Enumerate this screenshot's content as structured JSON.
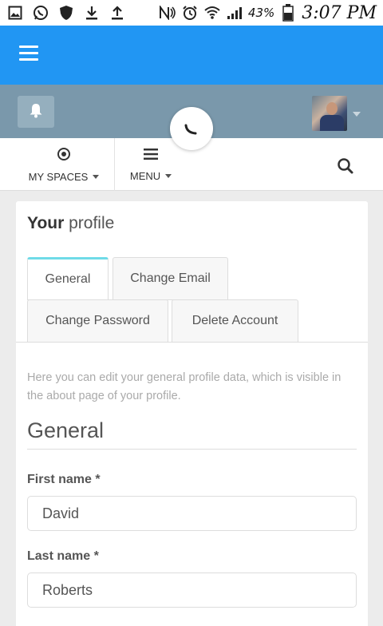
{
  "status_bar": {
    "battery_percent": "43%",
    "time": "3:07 PM",
    "icons": [
      "gallery-icon",
      "whatsapp-icon",
      "shield-icon",
      "download-icon",
      "upload-icon",
      "nfc-icon",
      "alarm-icon",
      "wifi-icon",
      "signal-icon",
      "battery-icon"
    ]
  },
  "colors": {
    "app_bar": "#2196f3",
    "account_bar": "#7a98ab",
    "active_tab_accent": "#6fdbe8"
  },
  "nav": {
    "spaces_label": "MY SPACES",
    "menu_label": "MENU"
  },
  "profile": {
    "title_bold": "Your",
    "title_rest": "profile",
    "tabs": [
      {
        "label": "General",
        "active": true
      },
      {
        "label": "Change Email",
        "active": false
      },
      {
        "label": "Change Password",
        "active": false
      },
      {
        "label": "Delete Account",
        "active": false
      }
    ],
    "help_text": "Here you can edit your general profile data, which is visible in the about page of your profile.",
    "section_title": "General",
    "fields": [
      {
        "label": "First name *",
        "value": "David"
      },
      {
        "label": "Last name *",
        "value": "Roberts"
      }
    ]
  }
}
